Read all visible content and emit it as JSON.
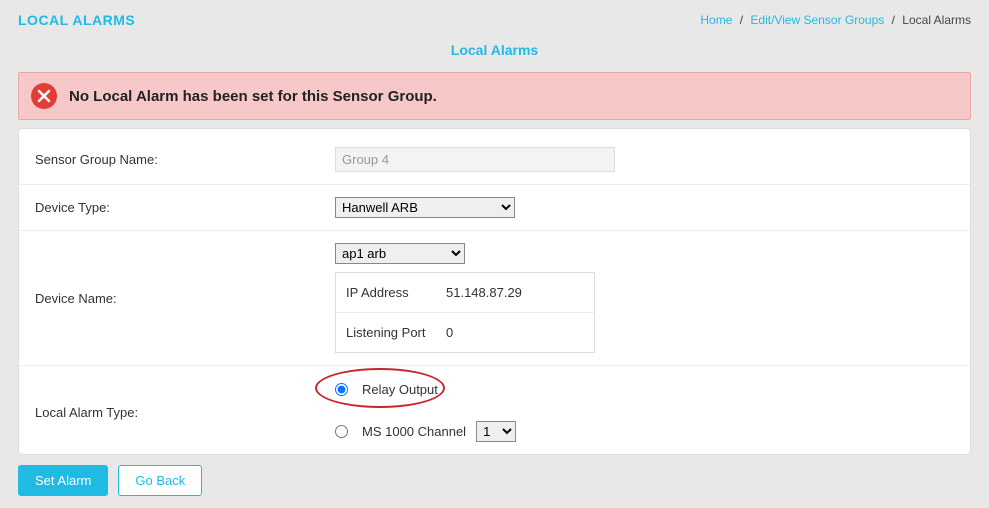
{
  "header": {
    "title": "LOCAL ALARMS",
    "breadcrumb": {
      "home": "Home",
      "group": "Edit/View Sensor Groups",
      "current": "Local Alarms"
    }
  },
  "subheader": "Local Alarms",
  "alert": {
    "message": "No Local Alarm has been set for this Sensor Group."
  },
  "form": {
    "sensor_group_label": "Sensor Group Name:",
    "sensor_group_value": "Group 4",
    "device_type_label": "Device Type:",
    "device_type_value": "Hanwell ARB",
    "device_name_label": "Device Name:",
    "device_name_value": "ap1 arb",
    "ip_label": "IP Address",
    "ip_value": "51.148.87.29",
    "port_label": "Listening Port",
    "port_value": "0",
    "alarm_type_label": "Local Alarm Type:",
    "relay_label": "Relay Output",
    "ms1000_label": "MS 1000 Channel",
    "ms1000_channel": "1"
  },
  "actions": {
    "set_alarm": "Set Alarm",
    "go_back": "Go Back"
  }
}
